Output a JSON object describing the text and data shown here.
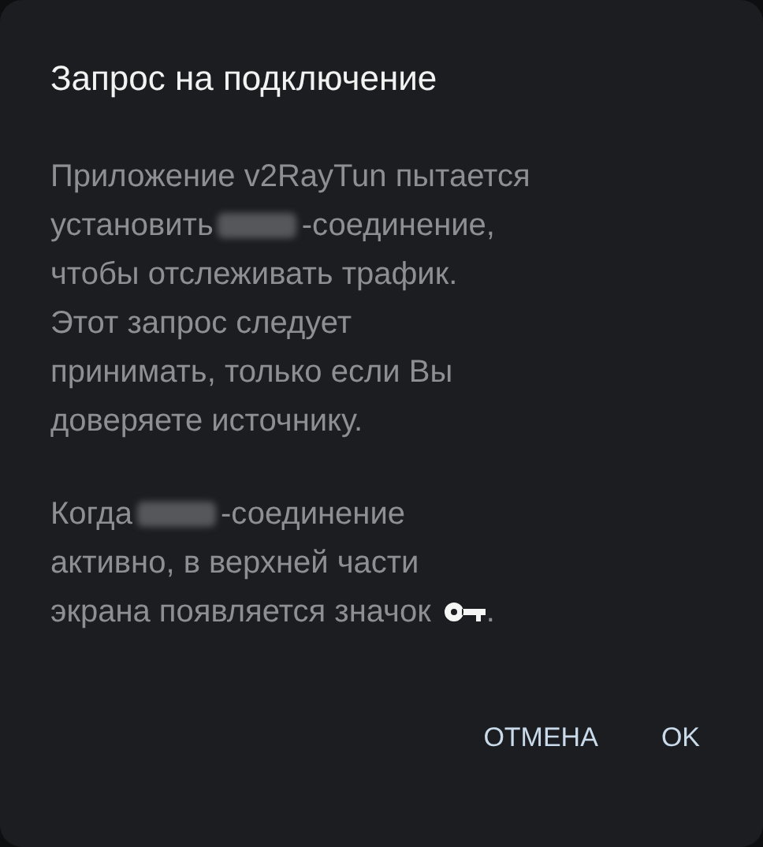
{
  "dialog": {
    "title": "Запрос на подключение",
    "paragraphs": [
      [
        [
          {
            "kind": "text",
            "text": "Приложение v2RayTun пытается"
          }
        ],
        [
          {
            "kind": "text",
            "text": "установить"
          },
          {
            "kind": "redacted"
          },
          {
            "kind": "text",
            "text": "-соединение,"
          }
        ],
        [
          {
            "kind": "text",
            "text": "чтобы отслеживать трафик."
          }
        ],
        [
          {
            "kind": "text",
            "text": "Этот запрос следует"
          }
        ],
        [
          {
            "kind": "text",
            "text": "принимать, только если Вы"
          }
        ],
        [
          {
            "kind": "text",
            "text": "доверяете источнику."
          }
        ]
      ],
      [
        [
          {
            "kind": "text",
            "text": "Когда"
          },
          {
            "kind": "redacted"
          },
          {
            "kind": "text",
            "text": "-соединение"
          }
        ],
        [
          {
            "kind": "text",
            "text": "активно, в верхней части"
          }
        ],
        [
          {
            "kind": "text",
            "text": "экрана появляется значок"
          },
          {
            "kind": "key_icon"
          },
          {
            "kind": "text",
            "text": "."
          }
        ]
      ]
    ],
    "buttons": [
      "ОТМЕНА",
      "OK"
    ]
  }
}
